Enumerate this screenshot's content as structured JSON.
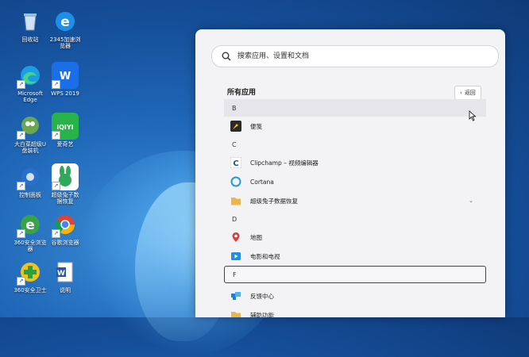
{
  "desktop": {
    "icons": [
      {
        "id": "recycle-bin",
        "label": "回收站"
      },
      {
        "id": "browser-2345",
        "label": "2345加速浏\n览器"
      },
      {
        "id": "edge",
        "label": "Microsoft\nEdge"
      },
      {
        "id": "wps",
        "label": "WPS 2019"
      },
      {
        "id": "tool-app",
        "label": "大白菜超级U\n盘装机"
      },
      {
        "id": "iqiyi",
        "label": "爱奇艺"
      },
      {
        "id": "control-panel",
        "label": "控制面板"
      },
      {
        "id": "rabbit-recovery",
        "label": "超级兔子数\n据恢复"
      },
      {
        "id": "ie-browser",
        "label": "360安全浏览\n器"
      },
      {
        "id": "chrome",
        "label": "谷歌浏览器"
      },
      {
        "id": "green-app",
        "label": "360安全卫士"
      },
      {
        "id": "word-doc",
        "label": "说明"
      }
    ]
  },
  "start_menu": {
    "search_placeholder": "搜索应用、设置和文档",
    "section_title": "所有应用",
    "back_label": "返回",
    "items": [
      {
        "type": "letter",
        "text": "B"
      },
      {
        "type": "app",
        "text": "便笺",
        "icon": "sticky-notes-icon"
      },
      {
        "type": "letter",
        "text": "C"
      },
      {
        "type": "app",
        "text": "Clipchamp – 视频编辑器",
        "icon": "clipchamp-icon"
      },
      {
        "type": "app",
        "text": "Cortana",
        "icon": "cortana-icon"
      },
      {
        "type": "app",
        "text": "超级兔子数据恢复",
        "icon": "folder-icon",
        "expandable": true
      },
      {
        "type": "letter",
        "text": "D"
      },
      {
        "type": "app",
        "text": "地图",
        "icon": "maps-icon"
      },
      {
        "type": "app",
        "text": "电影和电视",
        "icon": "movies-icon"
      },
      {
        "type": "letter",
        "text": "F"
      },
      {
        "type": "app",
        "text": "反馈中心",
        "icon": "feedback-icon"
      },
      {
        "type": "app",
        "text": "辅助功能",
        "icon": "folder-icon"
      }
    ]
  },
  "colors": {
    "accent_blue": "#0a78d7",
    "panel_bg": "#f3f3f5"
  }
}
